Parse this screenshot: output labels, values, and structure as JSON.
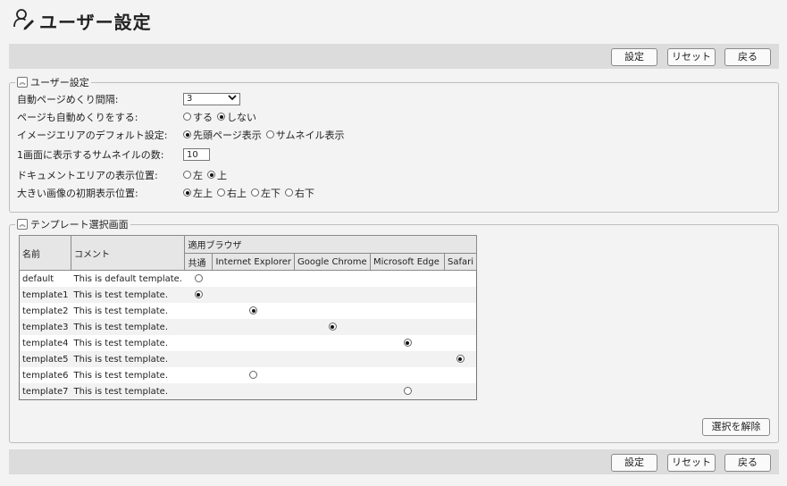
{
  "page": {
    "title": "ユーザー設定",
    "title_icon": "user-edit-icon"
  },
  "toolbar": {
    "set_label": "設定",
    "reset_label": "リセット",
    "back_label": "戻る"
  },
  "user_settings": {
    "legend": "ユーザー設定",
    "auto_interval": {
      "label": "自動ページめくり間隔:",
      "value": "3"
    },
    "auto_flip": {
      "label": "ページも自動めくりをする:",
      "options": [
        "する",
        "しない"
      ],
      "selected": 1
    },
    "image_area": {
      "label": "イメージエリアのデフォルト設定:",
      "options": [
        "先頭ページ表示",
        "サムネイル表示"
      ],
      "selected": 0
    },
    "thumb_count": {
      "label": "1画面に表示するサムネイルの数:",
      "value": "10"
    },
    "doc_area": {
      "label": "ドキュメントエリアの表示位置:",
      "options": [
        "左",
        "上"
      ],
      "selected": 1
    },
    "large_image": {
      "label": "大きい画像の初期表示位置:",
      "options": [
        "左上",
        "右上",
        "左下",
        "右下"
      ],
      "selected": 0
    }
  },
  "template_select": {
    "legend": "テンプレート選択画面",
    "headers": {
      "name": "名前",
      "comment": "コメント",
      "browsers": "適用ブラウザ",
      "cols": [
        "共通",
        "Internet Explorer",
        "Google Chrome",
        "Microsoft Edge",
        "Safari"
      ]
    },
    "rows": [
      {
        "name": "default",
        "comment": "This is default template.",
        "col": 0,
        "checked": false
      },
      {
        "name": "template1",
        "comment": "This is test template.",
        "col": 0,
        "checked": true
      },
      {
        "name": "template2",
        "comment": "This is test template.",
        "col": 1,
        "checked": true
      },
      {
        "name": "template3",
        "comment": "This is test template.",
        "col": 2,
        "checked": true
      },
      {
        "name": "template4",
        "comment": "This is test template.",
        "col": 3,
        "checked": true
      },
      {
        "name": "template5",
        "comment": "This is test template.",
        "col": 4,
        "checked": true
      },
      {
        "name": "template6",
        "comment": "This is test template.",
        "col": 1,
        "checked": false
      },
      {
        "name": "template7",
        "comment": "This is test template.",
        "col": 3,
        "checked": false
      }
    ],
    "clear_label": "選択を解除"
  }
}
